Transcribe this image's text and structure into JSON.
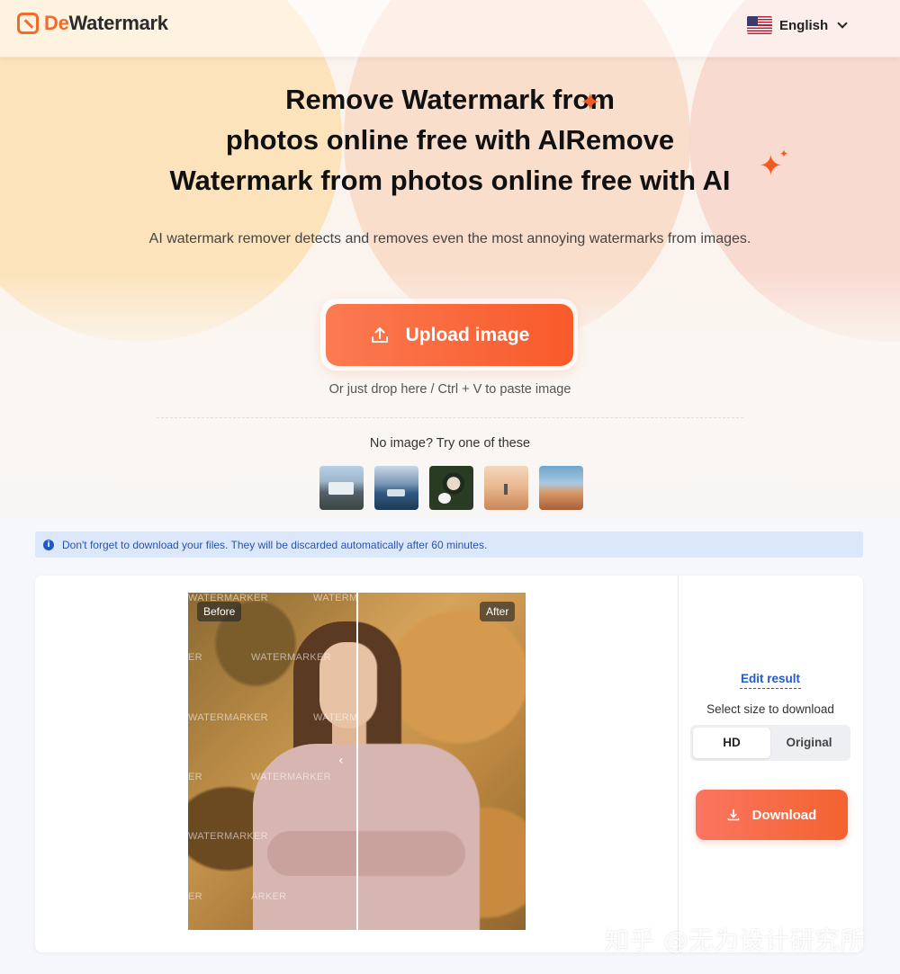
{
  "header": {
    "brand_prefix": "De",
    "brand_suffix": "Watermark",
    "language": "English"
  },
  "hero": {
    "title_lines": [
      "Remove Watermark from",
      "photos online free with AIRemove",
      "Watermark from photos online free with AI"
    ],
    "subtitle": "AI watermark remover detects and removes even the most annoying watermarks from images.",
    "upload_label": "Upload image",
    "drop_hint": "Or just drop here / Ctrl + V to paste image",
    "samples_title": "No image? Try one of these"
  },
  "notice": {
    "text": "Don't forget to download your files. They will be discarded automatically after 60 minutes."
  },
  "result": {
    "before_label": "Before",
    "after_label": "After",
    "watermark_text": "WATERMARKER",
    "watermark_text_short": "WATERM",
    "watermark_fragment_1": "ER",
    "watermark_fragment_2": "ARKER",
    "edit_label": "Edit result",
    "size_label": "Select size to download",
    "size_options": [
      "HD",
      "Original"
    ],
    "size_selected": "HD",
    "download_label": "Download"
  },
  "overlay": {
    "site_watermark": "知乎 @无为设计研究所"
  },
  "colors": {
    "accent": "#f26a2c",
    "link": "#2459c9",
    "notice_bg": "#dbe7fb"
  },
  "icons": [
    "brand-logo-icon",
    "us-flag-icon",
    "chevron-down-icon",
    "sparkle-icon",
    "upload-icon",
    "info-icon",
    "download-icon"
  ]
}
